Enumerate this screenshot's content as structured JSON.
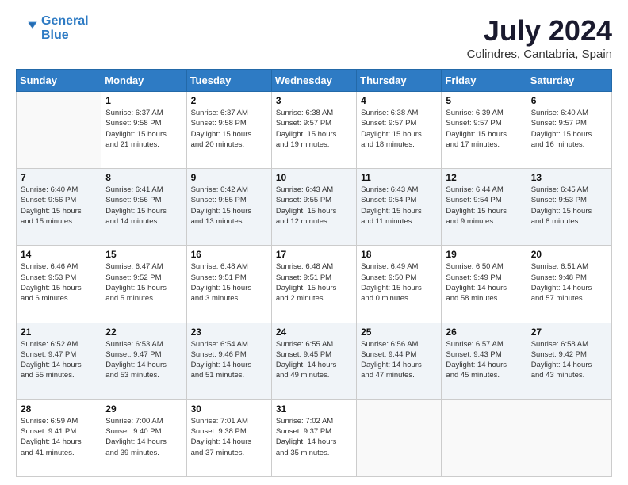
{
  "logo": {
    "line1": "General",
    "line2": "Blue"
  },
  "title": "July 2024",
  "subtitle": "Colindres, Cantabria, Spain",
  "weekdays": [
    "Sunday",
    "Monday",
    "Tuesday",
    "Wednesday",
    "Thursday",
    "Friday",
    "Saturday"
  ],
  "weeks": [
    [
      {
        "day": "",
        "info": ""
      },
      {
        "day": "1",
        "info": "Sunrise: 6:37 AM\nSunset: 9:58 PM\nDaylight: 15 hours\nand 21 minutes."
      },
      {
        "day": "2",
        "info": "Sunrise: 6:37 AM\nSunset: 9:58 PM\nDaylight: 15 hours\nand 20 minutes."
      },
      {
        "day": "3",
        "info": "Sunrise: 6:38 AM\nSunset: 9:57 PM\nDaylight: 15 hours\nand 19 minutes."
      },
      {
        "day": "4",
        "info": "Sunrise: 6:38 AM\nSunset: 9:57 PM\nDaylight: 15 hours\nand 18 minutes."
      },
      {
        "day": "5",
        "info": "Sunrise: 6:39 AM\nSunset: 9:57 PM\nDaylight: 15 hours\nand 17 minutes."
      },
      {
        "day": "6",
        "info": "Sunrise: 6:40 AM\nSunset: 9:57 PM\nDaylight: 15 hours\nand 16 minutes."
      }
    ],
    [
      {
        "day": "7",
        "info": "Sunrise: 6:40 AM\nSunset: 9:56 PM\nDaylight: 15 hours\nand 15 minutes."
      },
      {
        "day": "8",
        "info": "Sunrise: 6:41 AM\nSunset: 9:56 PM\nDaylight: 15 hours\nand 14 minutes."
      },
      {
        "day": "9",
        "info": "Sunrise: 6:42 AM\nSunset: 9:55 PM\nDaylight: 15 hours\nand 13 minutes."
      },
      {
        "day": "10",
        "info": "Sunrise: 6:43 AM\nSunset: 9:55 PM\nDaylight: 15 hours\nand 12 minutes."
      },
      {
        "day": "11",
        "info": "Sunrise: 6:43 AM\nSunset: 9:54 PM\nDaylight: 15 hours\nand 11 minutes."
      },
      {
        "day": "12",
        "info": "Sunrise: 6:44 AM\nSunset: 9:54 PM\nDaylight: 15 hours\nand 9 minutes."
      },
      {
        "day": "13",
        "info": "Sunrise: 6:45 AM\nSunset: 9:53 PM\nDaylight: 15 hours\nand 8 minutes."
      }
    ],
    [
      {
        "day": "14",
        "info": "Sunrise: 6:46 AM\nSunset: 9:53 PM\nDaylight: 15 hours\nand 6 minutes."
      },
      {
        "day": "15",
        "info": "Sunrise: 6:47 AM\nSunset: 9:52 PM\nDaylight: 15 hours\nand 5 minutes."
      },
      {
        "day": "16",
        "info": "Sunrise: 6:48 AM\nSunset: 9:51 PM\nDaylight: 15 hours\nand 3 minutes."
      },
      {
        "day": "17",
        "info": "Sunrise: 6:48 AM\nSunset: 9:51 PM\nDaylight: 15 hours\nand 2 minutes."
      },
      {
        "day": "18",
        "info": "Sunrise: 6:49 AM\nSunset: 9:50 PM\nDaylight: 15 hours\nand 0 minutes."
      },
      {
        "day": "19",
        "info": "Sunrise: 6:50 AM\nSunset: 9:49 PM\nDaylight: 14 hours\nand 58 minutes."
      },
      {
        "day": "20",
        "info": "Sunrise: 6:51 AM\nSunset: 9:48 PM\nDaylight: 14 hours\nand 57 minutes."
      }
    ],
    [
      {
        "day": "21",
        "info": "Sunrise: 6:52 AM\nSunset: 9:47 PM\nDaylight: 14 hours\nand 55 minutes."
      },
      {
        "day": "22",
        "info": "Sunrise: 6:53 AM\nSunset: 9:47 PM\nDaylight: 14 hours\nand 53 minutes."
      },
      {
        "day": "23",
        "info": "Sunrise: 6:54 AM\nSunset: 9:46 PM\nDaylight: 14 hours\nand 51 minutes."
      },
      {
        "day": "24",
        "info": "Sunrise: 6:55 AM\nSunset: 9:45 PM\nDaylight: 14 hours\nand 49 minutes."
      },
      {
        "day": "25",
        "info": "Sunrise: 6:56 AM\nSunset: 9:44 PM\nDaylight: 14 hours\nand 47 minutes."
      },
      {
        "day": "26",
        "info": "Sunrise: 6:57 AM\nSunset: 9:43 PM\nDaylight: 14 hours\nand 45 minutes."
      },
      {
        "day": "27",
        "info": "Sunrise: 6:58 AM\nSunset: 9:42 PM\nDaylight: 14 hours\nand 43 minutes."
      }
    ],
    [
      {
        "day": "28",
        "info": "Sunrise: 6:59 AM\nSunset: 9:41 PM\nDaylight: 14 hours\nand 41 minutes."
      },
      {
        "day": "29",
        "info": "Sunrise: 7:00 AM\nSunset: 9:40 PM\nDaylight: 14 hours\nand 39 minutes."
      },
      {
        "day": "30",
        "info": "Sunrise: 7:01 AM\nSunset: 9:38 PM\nDaylight: 14 hours\nand 37 minutes."
      },
      {
        "day": "31",
        "info": "Sunrise: 7:02 AM\nSunset: 9:37 PM\nDaylight: 14 hours\nand 35 minutes."
      },
      {
        "day": "",
        "info": ""
      },
      {
        "day": "",
        "info": ""
      },
      {
        "day": "",
        "info": ""
      }
    ]
  ]
}
